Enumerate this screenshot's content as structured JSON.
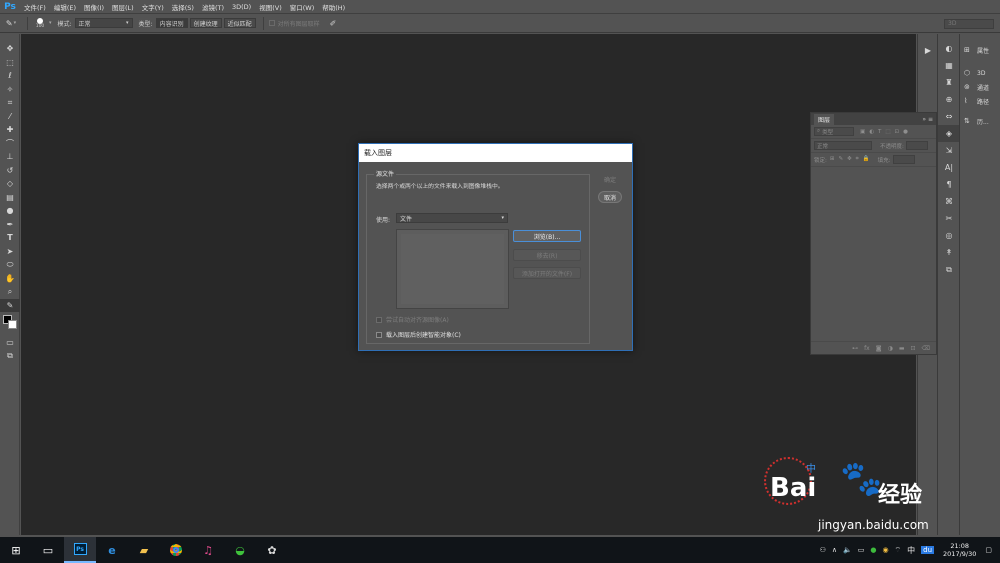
{
  "app": {
    "logo": "Ps",
    "menus": [
      "文件(F)",
      "编辑(E)",
      "图像(I)",
      "图层(L)",
      "文字(Y)",
      "选择(S)",
      "滤镜(T)",
      "3D(D)",
      "视图(V)",
      "窗口(W)",
      "帮助(H)"
    ]
  },
  "options_bar": {
    "brush_size": "100",
    "mode_label": "模式:",
    "mode_value": "正常",
    "type_label": "类型:",
    "type_buttons": [
      "内容识别",
      "创建纹理",
      "近似匹配"
    ],
    "sample_all_label": "对所有图层取样",
    "field_3d": "3D"
  },
  "right_panels": {
    "items": [
      {
        "icon": "properties-icon",
        "label": "属性"
      },
      {
        "icon": "3d-icon",
        "label": "3D"
      },
      {
        "icon": "channels-icon",
        "label": "通道"
      },
      {
        "icon": "paths-icon",
        "label": "路径"
      },
      {
        "icon": "history-icon",
        "label": "历..."
      }
    ]
  },
  "layers_panel": {
    "tab": "图层",
    "filter_placeholder": "类型",
    "blend_mode": "正常",
    "opacity_label": "不透明度:",
    "lock_label": "锁定:",
    "fill_label": "填充:"
  },
  "dialog": {
    "title": "载入图层",
    "group_label": "源文件",
    "hint": "选择两个或两个以上的文件来载入到图像堆栈中。",
    "use_label": "使用:",
    "use_value": "文件",
    "browse_label": "浏览(B)...",
    "remove_label": "移去(R)",
    "add_open_label": "添加打开的文件(F)",
    "ok_label": "确定",
    "cancel_label": "取消",
    "auto_align_label": "尝试自动对齐源图像(A)",
    "smart_object_label": "载入图层后创建智能对象(C)"
  },
  "watermark": {
    "url": "jingyan.baidu.com",
    "brand": "Bai",
    "brand_suffix": "经验",
    "zhong": "中"
  },
  "taskbar": {
    "ime": "中",
    "time": "21:08",
    "date": "2017/9/30"
  }
}
